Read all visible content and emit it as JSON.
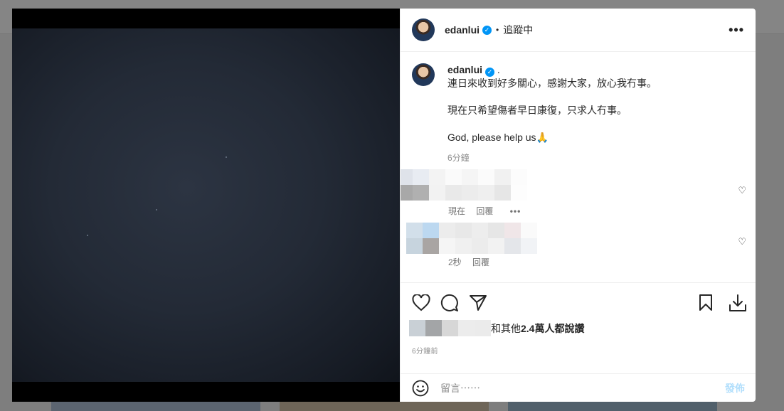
{
  "post": {
    "username": "edanlui",
    "following_status": "追蹤中",
    "more_label": "•••"
  },
  "caption": {
    "username": "edanlui",
    "suffix": ".",
    "text": "連日來收到好多關心，感謝大家，放心我冇事。\n\n現在只希望傷者早日康復，只求人冇事。\n\nGod, please help us🙏",
    "time": "6分鐘"
  },
  "comments": [
    {
      "time": "現在",
      "reply_label": "回覆",
      "more_label": "•••"
    },
    {
      "time": "2秒",
      "reply_label": "回覆"
    }
  ],
  "likes": {
    "text_prefix": "和其他",
    "count": "2.4",
    "text_suffix": " 萬人都說讚"
  },
  "time_ago": "6分鐘前",
  "add_comment": {
    "placeholder": "留言⋯⋯",
    "post_label": "發佈"
  },
  "colors": {
    "accent": "#0095f6",
    "post_disabled": "#b2dffc"
  }
}
